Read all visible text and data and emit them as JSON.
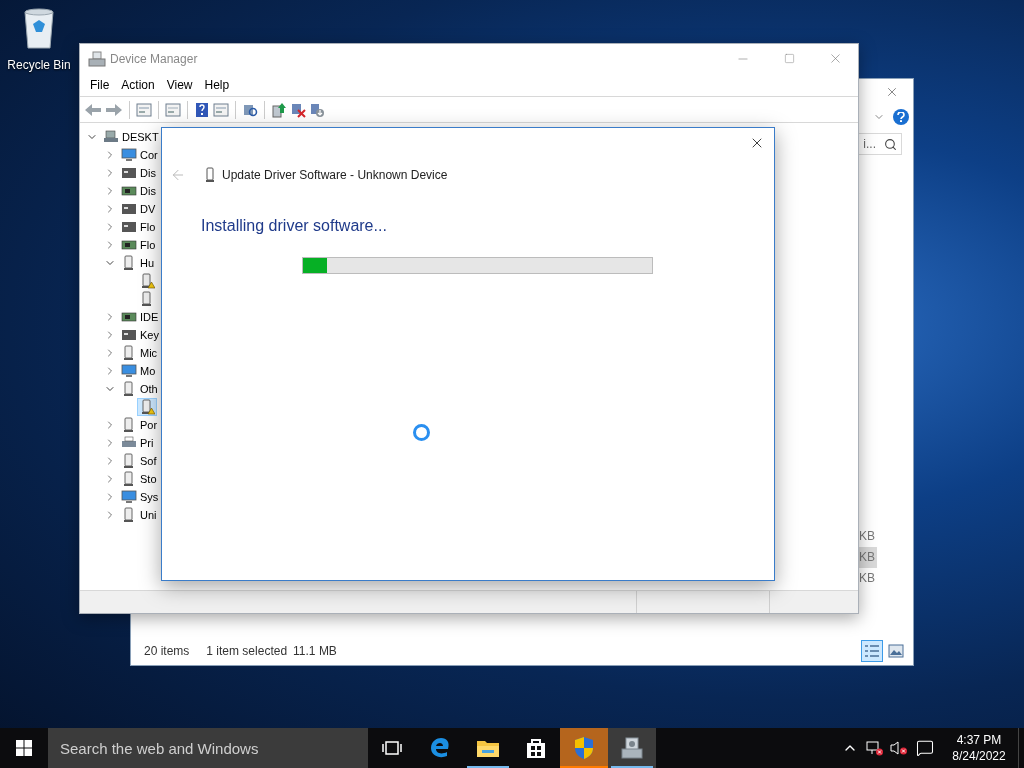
{
  "desktop_icons": [
    {
      "label": "Recycle Bin"
    }
  ],
  "explorer_window": {
    "search_text": "i...",
    "rows": [
      {
        "size": "KB",
        "selected": false
      },
      {
        "size": "KB",
        "selected": true
      },
      {
        "size": "KB",
        "selected": false
      }
    ],
    "status": {
      "items": "20 items",
      "selection": "1 item selected",
      "size": "11.1 MB"
    },
    "views": [
      {
        "selected": true
      },
      {
        "selected": false
      }
    ]
  },
  "device_manager": {
    "title": "Device Manager",
    "menu": [
      "File",
      "Action",
      "View",
      "Help"
    ],
    "tree": {
      "label": "DESKT",
      "expanded": true,
      "selected": false,
      "children": [
        {
          "label": "Cor",
          "expanded": false,
          "selected": false
        },
        {
          "label": "Dis",
          "expanded": false,
          "selected": false
        },
        {
          "label": "Dis",
          "expanded": false,
          "selected": false
        },
        {
          "label": "DV",
          "expanded": false,
          "selected": false
        },
        {
          "label": "Flo",
          "expanded": false,
          "selected": false
        },
        {
          "label": "Flo",
          "expanded": false,
          "selected": false
        },
        {
          "label": "Hu",
          "expanded": true,
          "selected": false,
          "children": [
            {
              "warning": true,
              "selected": false
            },
            {
              "warning": false,
              "selected": false
            }
          ]
        },
        {
          "label": "IDE",
          "expanded": false,
          "selected": false
        },
        {
          "label": "Key",
          "expanded": false,
          "selected": false
        },
        {
          "label": "Mic",
          "expanded": false,
          "selected": false
        },
        {
          "label": "Mo",
          "expanded": false,
          "selected": false
        },
        {
          "label": "Oth",
          "expanded": true,
          "selected": false,
          "children": [
            {
              "warning": true,
              "selected": true
            }
          ]
        },
        {
          "label": "Por",
          "expanded": false,
          "selected": false
        },
        {
          "label": "Pri",
          "expanded": false,
          "selected": false
        },
        {
          "label": "Sof",
          "expanded": false,
          "selected": false
        },
        {
          "label": "Sto",
          "expanded": false,
          "selected": false
        },
        {
          "label": "Sys",
          "expanded": false,
          "selected": false
        },
        {
          "label": "Uni",
          "expanded": false,
          "selected": false
        }
      ]
    }
  },
  "dialog": {
    "title": "Update Driver Software - Unknown Device",
    "heading": "Installing driver software...",
    "progress": {
      "level": 0.07
    }
  },
  "taskbar": {
    "search_placeholder": "Search the web and Windows",
    "apps": [
      {
        "running": false,
        "focused": false,
        "attention": false
      },
      {
        "running": false,
        "focused": false,
        "attention": false
      },
      {
        "running": true,
        "focused": false,
        "attention": false
      },
      {
        "running": false,
        "focused": false,
        "attention": false
      },
      {
        "running": true,
        "focused": false,
        "attention": true
      },
      {
        "running": true,
        "focused": true,
        "attention": false
      }
    ],
    "time": "4:37 PM",
    "date": "8/24/2022"
  }
}
